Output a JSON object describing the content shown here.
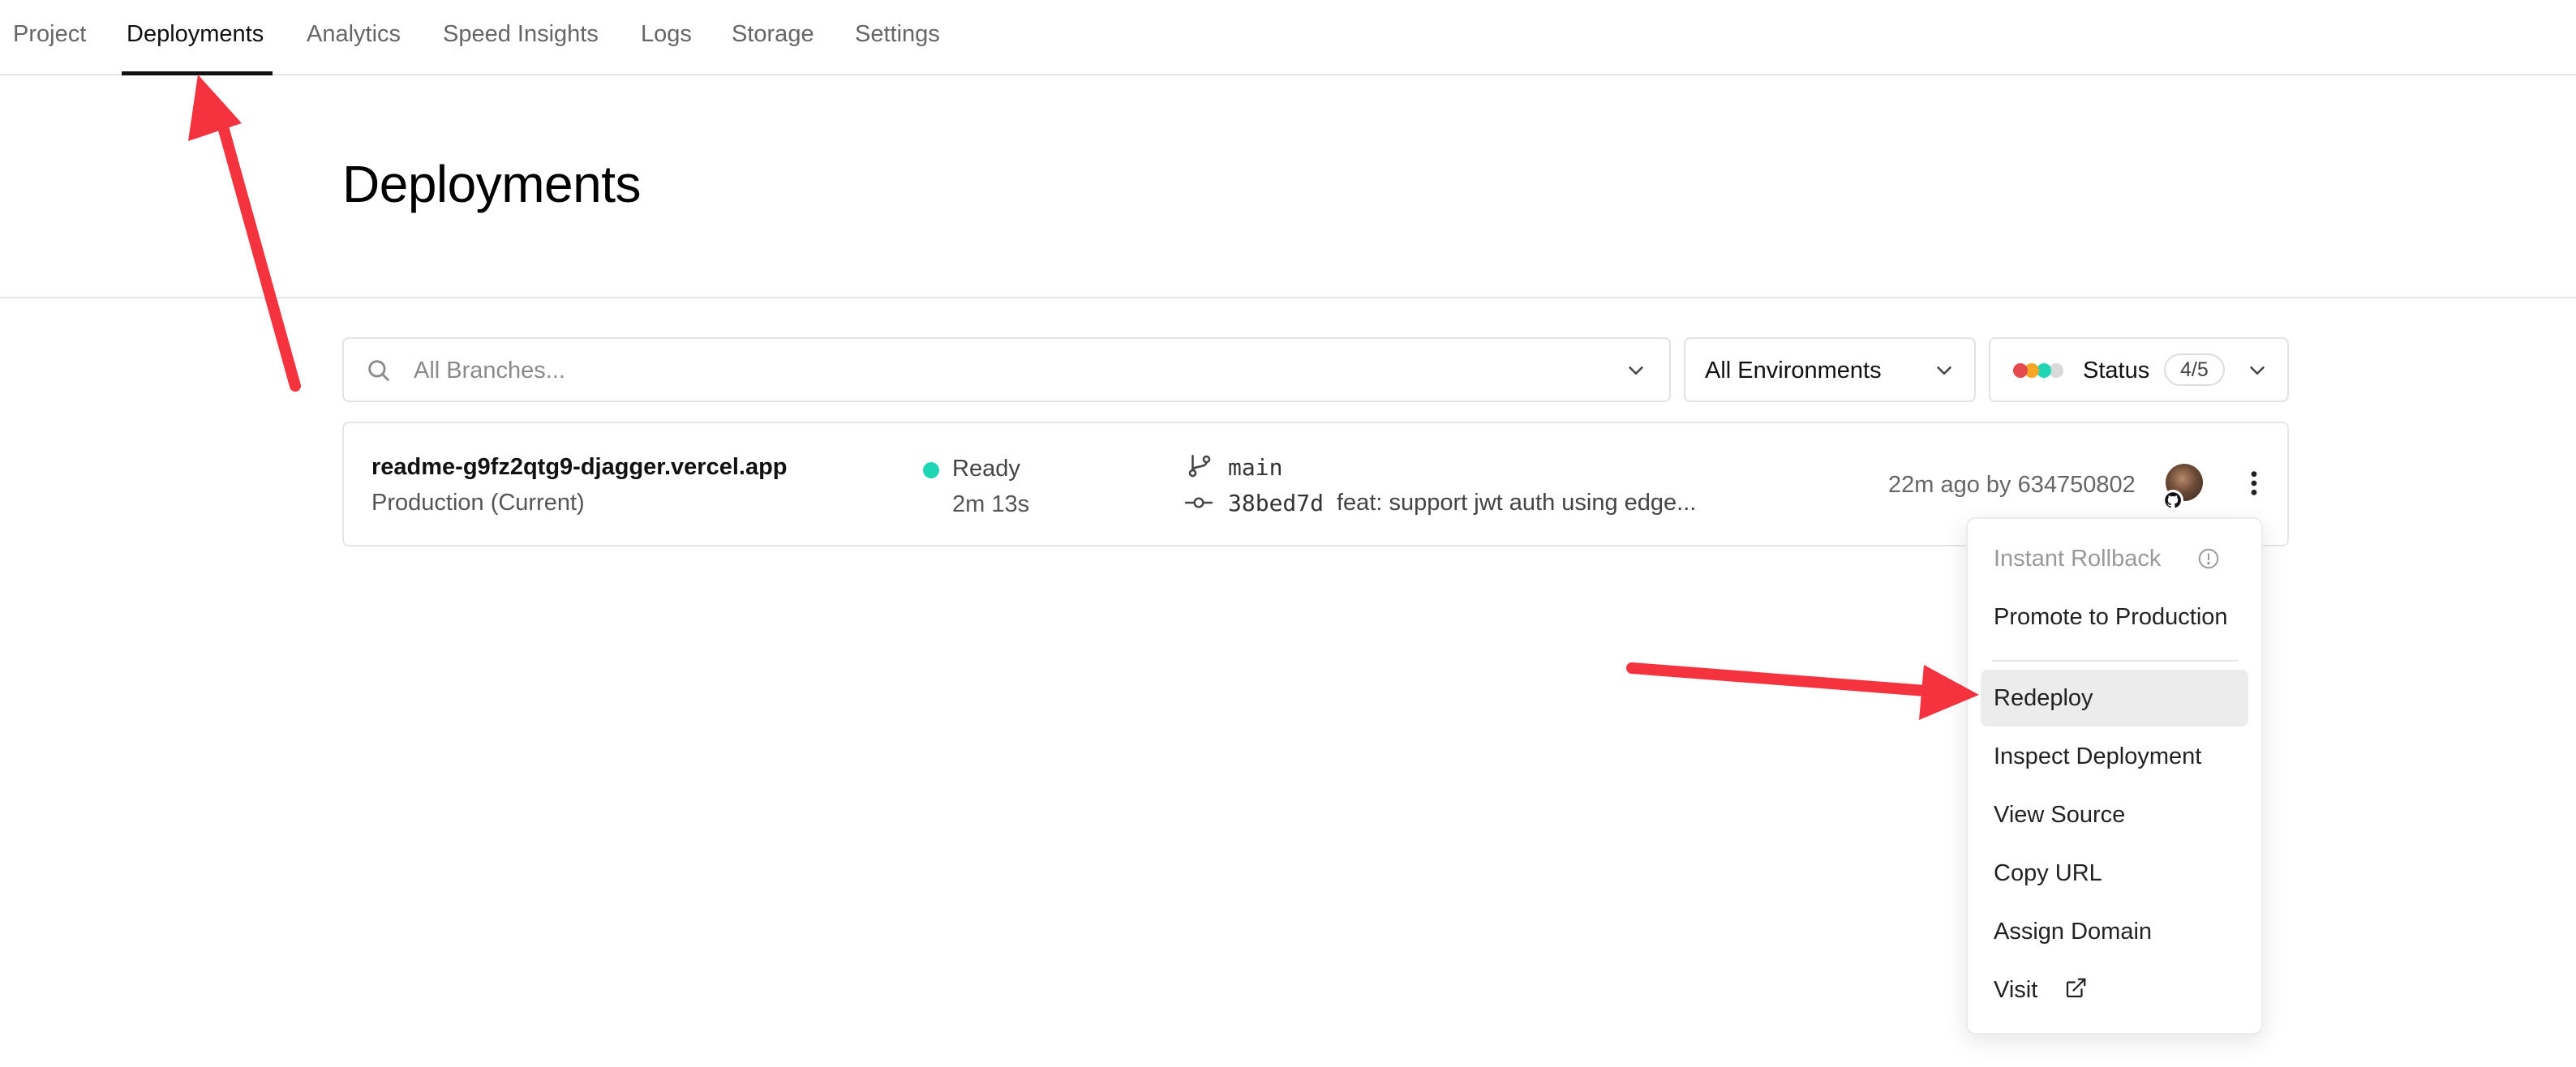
{
  "nav": {
    "tabs": [
      {
        "label": "Project"
      },
      {
        "label": "Deployments"
      },
      {
        "label": "Analytics"
      },
      {
        "label": "Speed Insights"
      },
      {
        "label": "Logs"
      },
      {
        "label": "Storage"
      },
      {
        "label": "Settings"
      }
    ],
    "active_tab": "Deployments"
  },
  "page": {
    "title": "Deployments"
  },
  "filters": {
    "search_placeholder": "All Branches...",
    "environment_value": "All Environments",
    "status_label": "Status",
    "status_count": "4/5",
    "status_dot_colors": [
      "#e5484d",
      "#f5a623",
      "#1ed6b3",
      "#d9d9d9"
    ]
  },
  "deployment": {
    "url": "readme-g9fz2qtg9-djagger.vercel.app",
    "environment": "Production (Current)",
    "status": "Ready",
    "status_color": "#1ed6b3",
    "duration": "2m 13s",
    "branch": "main",
    "commit_hash": "38bed7d",
    "commit_message": "feat: support jwt auth using edge...",
    "meta": "22m ago by 634750802"
  },
  "menu": {
    "items": [
      {
        "label": "Instant Rollback",
        "state": "disabled",
        "icon": "info-icon"
      },
      {
        "label": "Promote to Production",
        "state": "normal"
      },
      {
        "label": "Redeploy",
        "state": "highlighted"
      },
      {
        "label": "Inspect Deployment",
        "state": "normal"
      },
      {
        "label": "View Source",
        "state": "normal"
      },
      {
        "label": "Copy URL",
        "state": "normal"
      },
      {
        "label": "Assign Domain",
        "state": "normal"
      },
      {
        "label": "Visit",
        "state": "normal",
        "icon": "external-link-icon"
      }
    ]
  },
  "annotations": {
    "arrow_color": "#f5333f"
  }
}
